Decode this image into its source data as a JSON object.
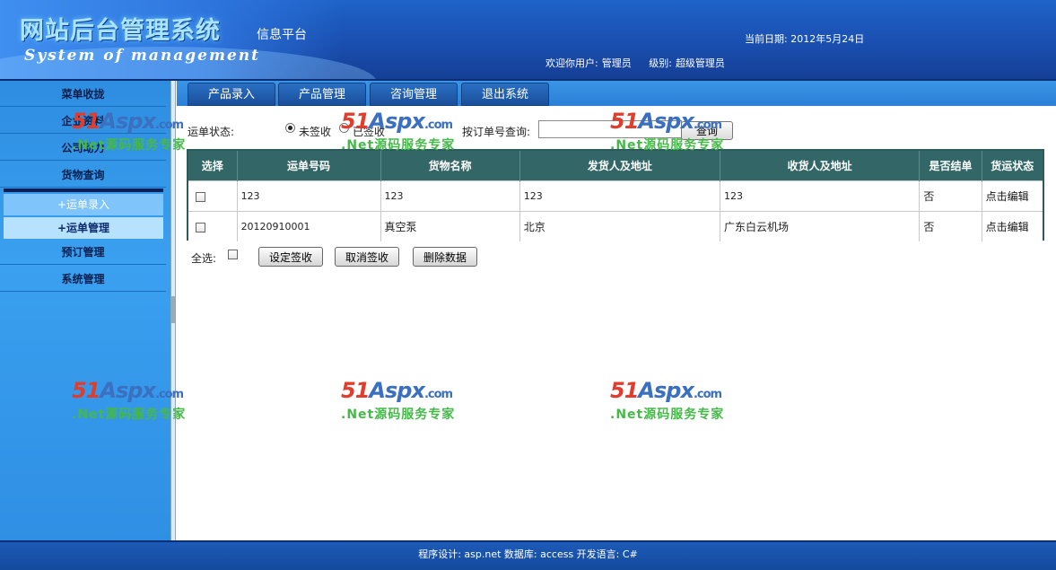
{
  "header": {
    "title": "网站后台管理系统",
    "subtitle": "System of management",
    "platform": "信息平台",
    "date_label": "当前日期:",
    "date_value": "2012年5月24日",
    "welcome_label": "欢迎你用户:",
    "user_name": "管理员",
    "level_label": "级别:",
    "level_value": "超级管理员"
  },
  "sidebar": {
    "menu_toggle": "菜单收拢",
    "items": [
      {
        "label": "企业资料"
      },
      {
        "label": "公司动力"
      },
      {
        "label": "货物查询"
      },
      {
        "label": "预订管理"
      },
      {
        "label": "系统管理"
      }
    ],
    "subitems": [
      {
        "label": "+运单录入"
      },
      {
        "label": "+运单管理"
      }
    ]
  },
  "tabs": [
    {
      "label": "产品录入"
    },
    {
      "label": "产品管理"
    },
    {
      "label": "咨询管理"
    },
    {
      "label": "退出系统"
    }
  ],
  "filter": {
    "status_label": "运单状态:",
    "options": [
      {
        "label": "未签收",
        "selected": true
      },
      {
        "label": "已签收",
        "selected": false
      }
    ],
    "search_label": "按订单号查询:",
    "search_value": "",
    "search_button": "查询"
  },
  "table": {
    "headers": [
      "选择",
      "运单号码",
      "货物名称",
      "发货人及地址",
      "收货人及地址",
      "是否结单",
      "货运状态"
    ],
    "rows": [
      {
        "id": "123",
        "goods": "123",
        "sender": "123",
        "receiver": "123",
        "closed": "否",
        "action": "点击编辑"
      },
      {
        "id": "20120910001",
        "goods": "真空泵",
        "sender": "北京",
        "receiver": "广东白云机场",
        "closed": "否",
        "action": "点击编辑"
      }
    ]
  },
  "actions": {
    "select_all_label": "全选:",
    "set_signed": "设定签收",
    "cancel_signed": "取消签收",
    "delete": "删除数据"
  },
  "watermark": {
    "logo_num": "51",
    "logo_text": "Aspx",
    "logo_domain": ".com",
    "tagline": ".Net源码服务专家"
  },
  "footer": {
    "text": "程序设计: asp.net 数据库: access 开发语言: C#"
  },
  "colors": {
    "header_blue": "#1a4fb0",
    "sidebar_blue": "#3aa0ef",
    "table_header": "#336666",
    "watermark_red": "#e23c2c",
    "watermark_green": "#46b84a"
  }
}
